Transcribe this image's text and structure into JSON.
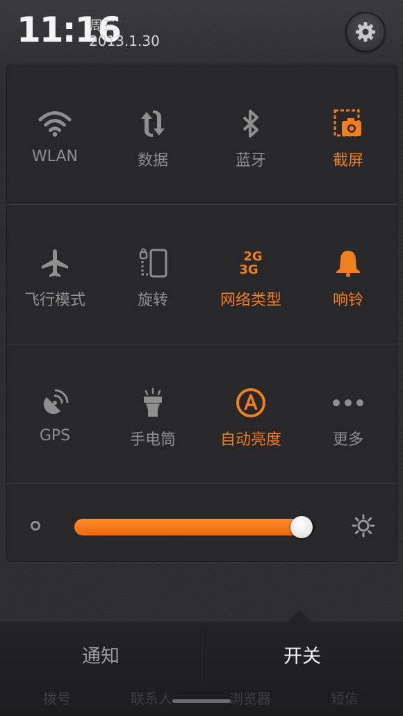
{
  "header": {
    "time": "11:16",
    "weekday": "周三",
    "date": "2013.1.30",
    "settings_icon": "gear-icon"
  },
  "toggles": [
    {
      "label": "WLAN",
      "icon": "wifi-icon",
      "active": false
    },
    {
      "label": "数据",
      "icon": "data-sync-icon",
      "active": false
    },
    {
      "label": "蓝牙",
      "icon": "bluetooth-icon",
      "active": false
    },
    {
      "label": "截屏",
      "icon": "screenshot-icon",
      "active": true
    },
    {
      "label": "飞行模式",
      "icon": "airplane-icon",
      "active": false
    },
    {
      "label": "旋转",
      "icon": "rotate-icon",
      "active": false
    },
    {
      "label": "网络类型",
      "icon": "network-type-icon",
      "active": true
    },
    {
      "label": "响铃",
      "icon": "bell-icon",
      "active": true
    },
    {
      "label": "GPS",
      "icon": "gps-icon",
      "active": false
    },
    {
      "label": "手电筒",
      "icon": "flashlight-icon",
      "active": false
    },
    {
      "label": "自动亮度",
      "icon": "auto-brightness-icon",
      "active": true
    },
    {
      "label": "更多",
      "icon": "more-icon",
      "active": false
    }
  ],
  "network_type_text": {
    "top": "2G",
    "bottom": "3G"
  },
  "brightness": {
    "level": 0.99
  },
  "tabs": {
    "notifications": "通知",
    "switches": "开关"
  },
  "dock_labels": [
    "拨号",
    "联系人",
    "浏览器",
    "短信"
  ],
  "colors": {
    "accent": "#f07f1e",
    "inactive": "#8f8f8f"
  }
}
